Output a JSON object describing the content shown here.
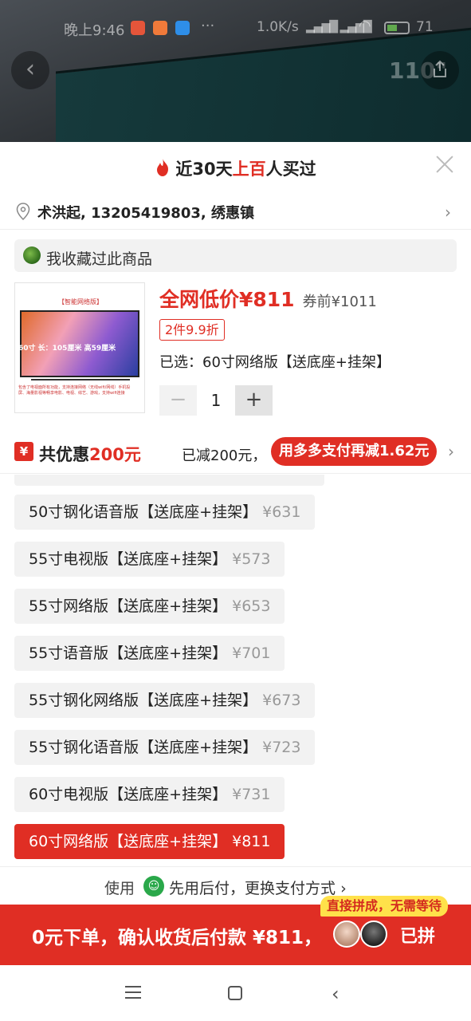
{
  "status_bar": {
    "time": "晚上9:46",
    "more": "···",
    "net_speed": "1.0K/s",
    "signal": "HD",
    "battery": "71"
  },
  "backdrop": {
    "size_tag": "110\""
  },
  "sheet": {
    "header": {
      "prefix": "近30天",
      "highlight": "上百",
      "suffix": "人买过"
    },
    "address": "术洪起, 13205419803, 绣惠镇",
    "favorite": "我收藏过此商品",
    "thumb": {
      "caption": "【智能网络版】",
      "dimensions": "60寸 长：105厘米 高59厘米",
      "notes": "包含了电视面所有功能，支持连接网络（无线wifi/网线）手机投屏、海量影视等畅享电影、电视、综艺、游戏，支持wifi连接"
    },
    "price": {
      "main": "全网低价¥811",
      "original": "券前¥1011"
    },
    "discount_tag": "2件9.9折",
    "selected": "已选：60寸网络版【送底座+挂架】",
    "stepper": {
      "minus": "−",
      "quantity": "1",
      "plus": "+"
    },
    "promo": {
      "icon": "¥",
      "label": "共优惠",
      "amount": "200元",
      "reduced": "已减200元，",
      "pill": "用多多支付再减1.62元"
    },
    "variants": [
      {
        "name": "50寸钢化语音版【送底座+挂架】",
        "price": "¥631",
        "selected": false
      },
      {
        "name": "55寸电视版【送底座+挂架】",
        "price": "¥573",
        "selected": false
      },
      {
        "name": "55寸网络版【送底座+挂架】",
        "price": "¥653",
        "selected": false
      },
      {
        "name": "55寸语音版【送底座+挂架】",
        "price": "¥701",
        "selected": false
      },
      {
        "name": "55寸钢化网络版【送底座+挂架】",
        "price": "¥673",
        "selected": false
      },
      {
        "name": "55寸钢化语音版【送底座+挂架】",
        "price": "¥723",
        "selected": false
      },
      {
        "name": "60寸电视版【送底座+挂架】",
        "price": "¥731",
        "selected": false
      },
      {
        "name": "60寸网络版【送底座+挂架】",
        "price": "¥811",
        "selected": true
      }
    ],
    "paylater": {
      "prefix": "使用",
      "text": "先用后付，更换支付方式",
      "chevron": "›"
    },
    "cta": {
      "tag": "直接拼成，无需等待",
      "text": "0元下单，确认收货后付款 ¥811，",
      "joined": "已拼"
    }
  },
  "colors": {
    "accent": "#e02e24",
    "chip_bg": "#f2f2f2",
    "tag_yellow": "#ffe14a"
  }
}
